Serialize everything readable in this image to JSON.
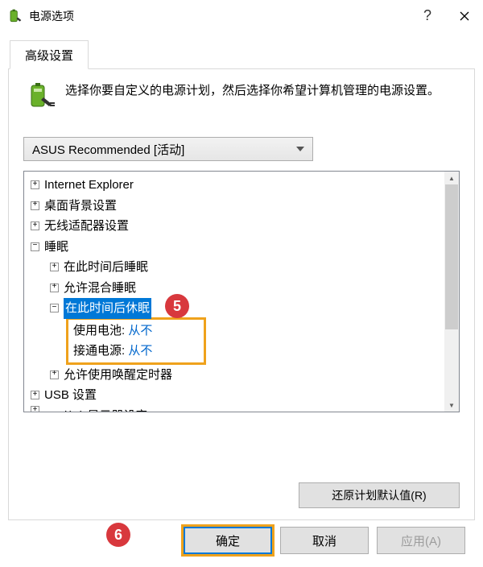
{
  "title": "电源选项",
  "tabs": {
    "advanced": "高级设置"
  },
  "description": "选择你要自定义的电源计划，然后选择你希望计算机管理的电源设置。",
  "plan_selected": "ASUS Recommended [活动]",
  "tree": {
    "ie": "Internet Explorer",
    "desktop_bg": "桌面背景设置",
    "wireless": "无线适配器设置",
    "sleep": "睡眠",
    "sleep_after": "在此时间后睡眠",
    "hybrid": "允许混合睡眠",
    "hibernate_after": "在此时间后休眠",
    "on_battery_label": "使用电池:",
    "on_battery_value": "从不",
    "plugged_label": "接通电源:",
    "plugged_value": "从不",
    "wake_timers": "允许使用唤醒定时器",
    "usb": "USB 设置",
    "intel_gfx_partial": "Intel(R) 显示器设定"
  },
  "buttons": {
    "restore_defaults": "还原计划默认值(R)",
    "ok": "确定",
    "cancel": "取消",
    "apply": "应用(A)"
  },
  "annotations": {
    "a5": "5",
    "a6": "6"
  }
}
